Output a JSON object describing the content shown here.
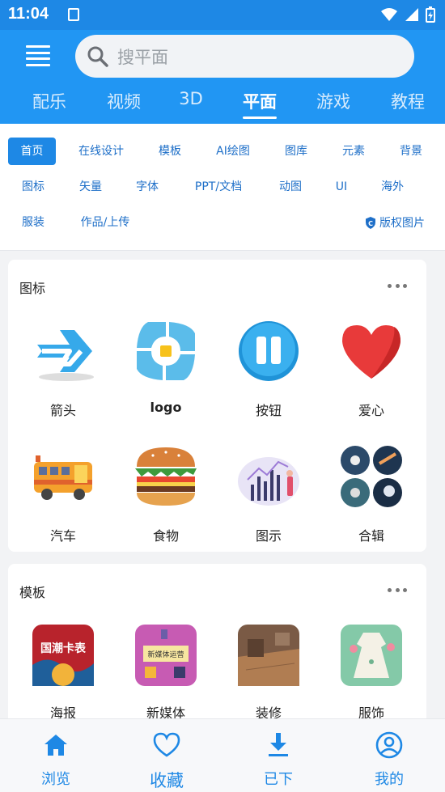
{
  "status": {
    "time": "11:04"
  },
  "search": {
    "placeholder": "搜平面"
  },
  "categories": [
    {
      "label": "配乐"
    },
    {
      "label": "视频"
    },
    {
      "label": "3D"
    },
    {
      "label": "平面"
    },
    {
      "label": "游戏"
    },
    {
      "label": "教程"
    }
  ],
  "tags": {
    "row1": [
      "首页",
      "在线设计",
      "模板",
      "AI绘图",
      "图库",
      "元素",
      "背景"
    ],
    "row2": [
      "图标",
      "矢量",
      "字体",
      "PPT/文档",
      "动图",
      "UI",
      "海外"
    ],
    "row3": [
      "服装",
      "作品/上传"
    ],
    "copyright": "版权图片"
  },
  "icons_section": {
    "title": "图标",
    "items": [
      "箭头",
      "logo",
      "按钮",
      "爱心",
      "汽车",
      "食物",
      "图示",
      "合辑"
    ]
  },
  "templates_section": {
    "title": "模板",
    "items": [
      "海报",
      "新媒体",
      "装修",
      "服饰"
    ],
    "poster_text": "国潮卡表",
    "media_text": "新媒体运营"
  },
  "bottom_nav": [
    "浏览",
    "收藏",
    "已下",
    "我的"
  ],
  "colors": {
    "primary": "#2196f3",
    "accent": "#1e88e5"
  }
}
